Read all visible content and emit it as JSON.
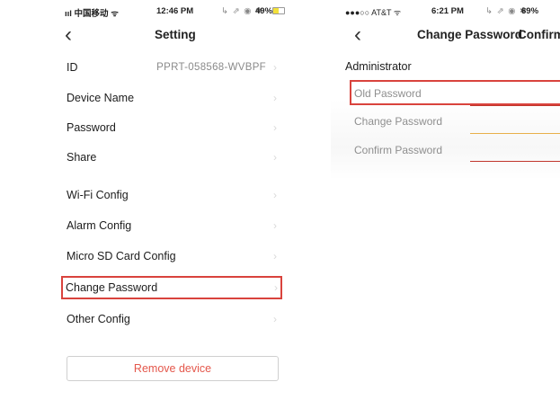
{
  "left": {
    "status": {
      "carrier": "ııl 中国移动 ᯤ",
      "time": "12:46 PM",
      "icons": "↳ ⇗ ◉ ✱",
      "battery": "49%"
    },
    "nav": {
      "back": "‹",
      "title": "Setting"
    },
    "rows": [
      {
        "label": "ID",
        "value": "PPRT-058568-WVBPF",
        "chevron": "›"
      },
      {
        "label": "Device Name",
        "chevron": "›"
      },
      {
        "label": "Password",
        "chevron": "›"
      },
      {
        "label": "Share",
        "chevron": "›"
      },
      {
        "label": "Wi-Fi Config",
        "chevron": "›"
      },
      {
        "label": "Alarm Config",
        "chevron": "›"
      },
      {
        "label": "Micro SD Card Config",
        "chevron": "›"
      },
      {
        "label": "Change Password",
        "chevron": "›"
      },
      {
        "label": "Other Config",
        "chevron": "›"
      }
    ],
    "remove_label": "Remove device"
  },
  "right": {
    "status": {
      "carrier": "●●●○○ AT&T ᯤ",
      "time": "6:21 PM",
      "icons": "↳ ⇗ ◉ ✱",
      "battery": "69%"
    },
    "nav": {
      "back": "‹",
      "title": "Change Password",
      "action": "Confirm"
    },
    "section": "Administrator",
    "fields": [
      {
        "label": "Old Password"
      },
      {
        "label": "Change Password"
      },
      {
        "label": "Confirm Password"
      }
    ]
  },
  "colors": {
    "highlight": "#d9433d",
    "danger_text": "#e4574b",
    "underline": "#e8b04a",
    "underline_red": "#c0362c"
  }
}
